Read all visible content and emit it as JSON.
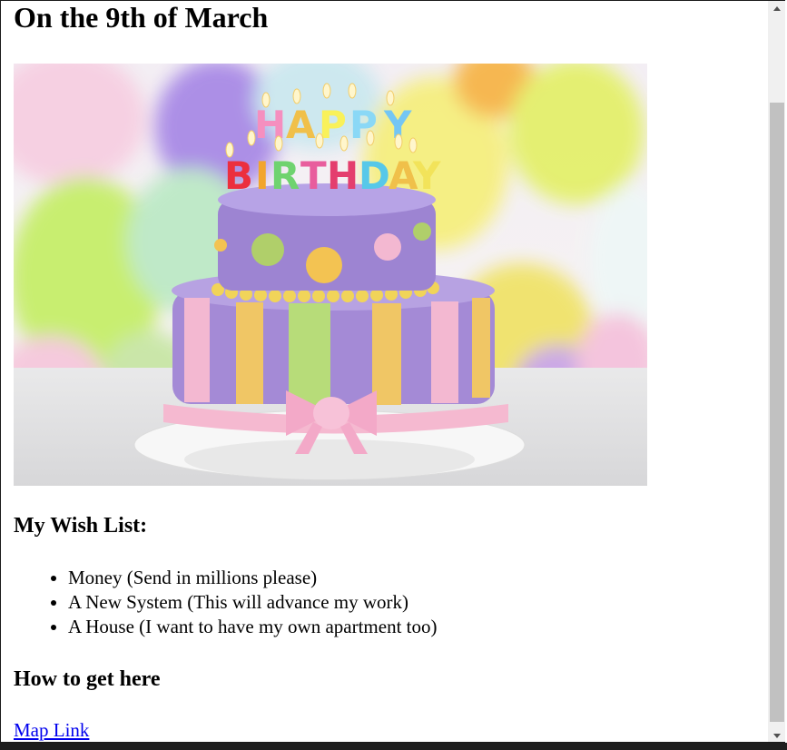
{
  "page": {
    "title": "On the 9th of March",
    "image_alt": "Happy Birthday cake with balloons",
    "cake_candles_text": "HAPPY BIRTHDAY",
    "wish_list": {
      "heading": "My Wish List:",
      "items": [
        "Money (Send in millions please)",
        "A New System (This will advance my work)",
        "A House (I want to have my own apartment too)"
      ]
    },
    "directions": {
      "heading": "How to get here",
      "link_label": "Map Link"
    }
  },
  "colors": {
    "link": "#0000ee",
    "scrollbar_thumb": "#c1c1c1",
    "scrollbar_track": "#f0f0f0"
  }
}
